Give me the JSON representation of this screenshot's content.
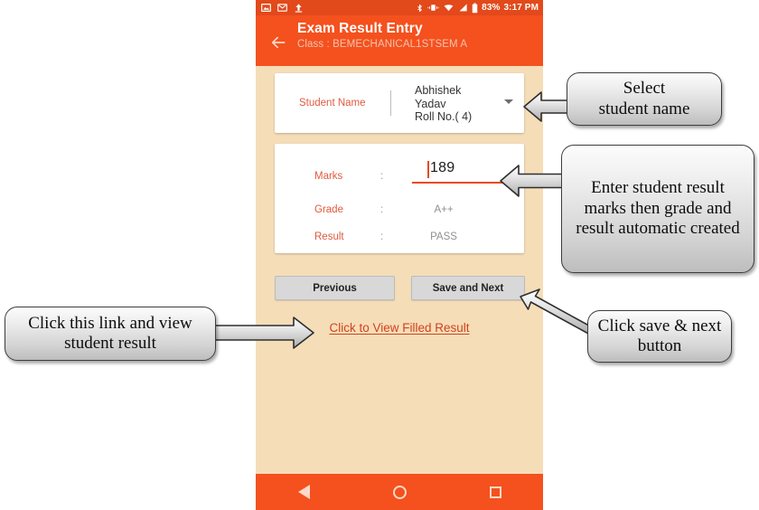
{
  "status_bar": {
    "icons": [
      "image-icon",
      "gmail-icon",
      "upload-icon",
      "bluetooth-icon",
      "vibrate-icon",
      "wifi-icon",
      "signal-icon",
      "battery-icon"
    ],
    "battery_percent": "83%",
    "time": "3:17 PM",
    "background": "#e2491b"
  },
  "app_bar": {
    "back_icon": "back-arrow-icon",
    "title": "Exam Result Entry",
    "subtitle": "Class : BEMECHANICAL1STSEM A",
    "background": "#f4511e"
  },
  "student_card": {
    "label": "Student Name",
    "separator": "",
    "value_line1": "Abhishek",
    "value_line2": "Yadav",
    "value_line3": "Roll No.( 4)",
    "dropdown_icon": "chevron-down-icon"
  },
  "result_card": {
    "rows": [
      {
        "label": "Marks",
        "sep": ":",
        "value": "189"
      },
      {
        "label": "Grade",
        "sep": ":",
        "value": "A++"
      },
      {
        "label": "Result",
        "sep": ":",
        "value": "PASS"
      }
    ]
  },
  "buttons": {
    "previous": "Previous",
    "save_and_next": "Save and Next"
  },
  "link": {
    "view_filled_result": "Click to View Filled Result"
  },
  "nav_bar": {
    "back": "back-triangle-icon",
    "home": "home-circle-icon",
    "recents": "recents-square-icon",
    "background": "#f4511e"
  },
  "callouts": {
    "select_student": "Select\nstudent name",
    "enter_marks": "Enter student result marks then grade and result automatic created",
    "view_result_link": "Click this link and view student result",
    "save_next": "Click save & next button"
  },
  "colors": {
    "accent_orange": "#f4511e",
    "status_orange": "#e2491b",
    "page_beige": "#f5ddb8",
    "label_orange": "#e05a3e",
    "link_orange": "#d1431d",
    "button_gray": "#d8d8d8"
  }
}
